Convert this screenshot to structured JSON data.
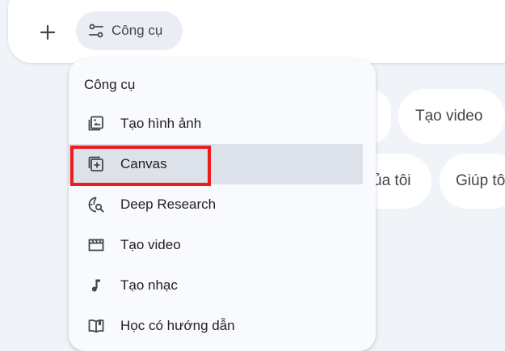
{
  "toolbar": {
    "plus_icon": "plus-icon",
    "tools_label": "Công cụ",
    "tools_icon": "tune-icon"
  },
  "chips": [
    {
      "label": "Tạo video"
    },
    {
      "label": "ủa tôi"
    },
    {
      "label": "Giúp tô"
    }
  ],
  "menu": {
    "title": "Công cụ",
    "items": [
      {
        "label": "Tạo hình ảnh",
        "icon": "image-gallery-icon"
      },
      {
        "label": "Canvas",
        "icon": "canvas-add-icon",
        "selected": true
      },
      {
        "label": "Deep Research",
        "icon": "deep-research-icon"
      },
      {
        "label": "Tạo video",
        "icon": "clapperboard-icon"
      },
      {
        "label": "Tạo nhạc",
        "icon": "music-note-icon"
      },
      {
        "label": "Học có hướng dẫn",
        "icon": "open-book-icon"
      }
    ]
  },
  "annotation": {
    "highlight_color": "#ee1c1c"
  }
}
